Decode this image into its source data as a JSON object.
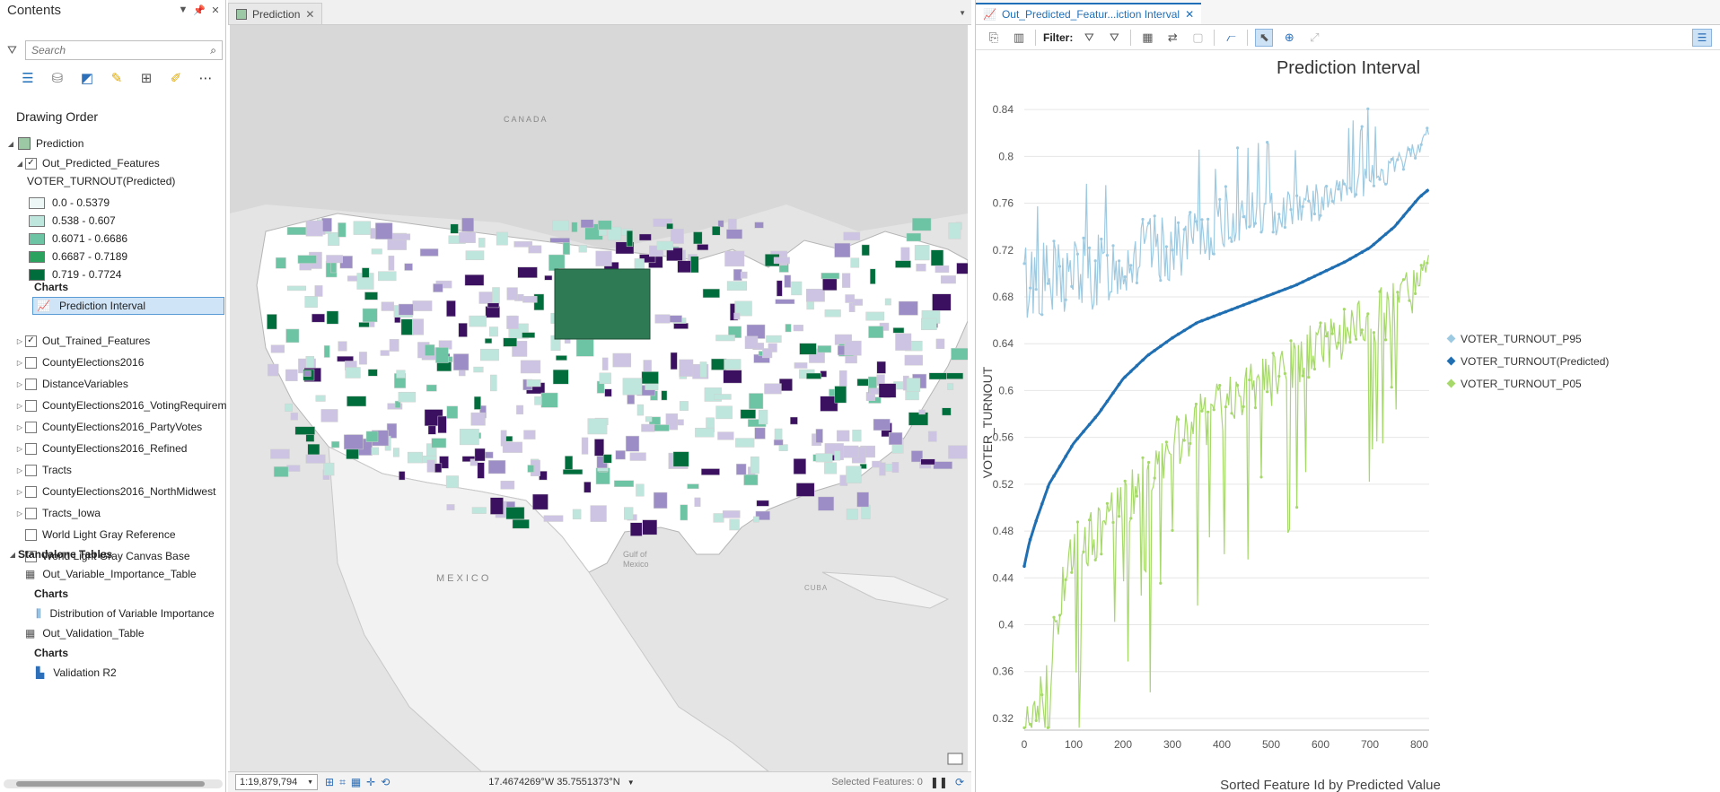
{
  "contents": {
    "title": "Contents",
    "search_placeholder": "Search",
    "drawing_order": "Drawing Order",
    "map_name": "Prediction",
    "layer_predicted": "Out_Predicted_Features",
    "legend_title": "VOTER_TURNOUT(Predicted)",
    "legend": [
      {
        "label": "0.0 - 0.5379",
        "color": "#edf8f6"
      },
      {
        "label": "0.538 - 0.607",
        "color": "#bfe6dc"
      },
      {
        "label": "0.6071 - 0.6686",
        "color": "#6cc4a4"
      },
      {
        "label": "0.6687 - 0.7189",
        "color": "#2ca25f"
      },
      {
        "label": "0.719 - 0.7724",
        "color": "#006d3c"
      }
    ],
    "charts_label": "Charts",
    "chart_prediction_interval": "Prediction Interval",
    "layers": [
      {
        "name": "Out_Trained_Features",
        "checked": true
      },
      {
        "name": "CountyElections2016",
        "checked": false
      },
      {
        "name": "DistanceVariables",
        "checked": false
      },
      {
        "name": "CountyElections2016_VotingRequirem",
        "checked": false
      },
      {
        "name": "CountyElections2016_PartyVotes",
        "checked": false
      },
      {
        "name": "CountyElections2016_Refined",
        "checked": false
      },
      {
        "name": "Tracts",
        "checked": false
      },
      {
        "name": "CountyElections2016_NorthMidwest",
        "checked": false
      },
      {
        "name": "Tracts_Iowa",
        "checked": false
      },
      {
        "name": "World Light Gray Reference",
        "checked": false
      },
      {
        "name": "World Light Gray Canvas Base",
        "checked": true
      }
    ],
    "standalone_tables": "Standalone Tables",
    "table1": "Out_Variable_Importance_Table",
    "table1_charts": "Charts",
    "table1_chart": "Distribution of Variable Importance",
    "table2": "Out_Validation_Table",
    "table2_charts": "Charts",
    "table2_chart": "Validation R2"
  },
  "map": {
    "tab_label": "Prediction",
    "labels": {
      "canada": "CANADA",
      "mexico": "MEXICO",
      "gulf1": "Gulf of",
      "gulf2": "Mexico",
      "cuba": "CUBA"
    },
    "scale": "1:19,879,794",
    "coords": "17.4674269°W 35.7551373°N",
    "selected_features": "Selected Features: 0",
    "colors": {
      "purple_light": "#cdc3e3",
      "purple_mid": "#9c8dc6",
      "purple_dark": "#3b1060",
      "basemap": "#e6e6e6",
      "land": "#ffffff"
    }
  },
  "chart_tab": {
    "label": "Out_Predicted_Featur...iction Interval",
    "filter_label": "Filter:"
  },
  "chart_data": {
    "type": "line",
    "title": "Prediction Interval",
    "xlabel": "Sorted Feature Id by Predicted Value",
    "ylabel": "VOTER_TURNOUT",
    "xlim": [
      0,
      820
    ],
    "ylim": [
      0.31,
      0.86
    ],
    "xticks": [
      0,
      100,
      200,
      300,
      400,
      500,
      600,
      700,
      800
    ],
    "yticks": [
      0.32,
      0.36,
      0.4,
      0.44,
      0.48,
      0.52,
      0.56,
      0.6,
      0.64,
      0.68,
      0.72,
      0.76,
      0.8,
      0.84
    ],
    "legend_position": "right",
    "series": [
      {
        "name": "VOTER_TURNOUT_P95",
        "color": "#9ecae1",
        "x": [
          0,
          25,
          50,
          100,
          150,
          200,
          250,
          300,
          350,
          400,
          450,
          500,
          550,
          600,
          650,
          700,
          750,
          800,
          820
        ],
        "y": [
          0.69,
          0.7,
          0.69,
          0.7,
          0.7,
          0.71,
          0.72,
          0.72,
          0.73,
          0.74,
          0.75,
          0.75,
          0.76,
          0.76,
          0.77,
          0.78,
          0.79,
          0.81,
          0.82
        ]
      },
      {
        "name": "VOTER_TURNOUT(Predicted)",
        "color": "#1f6fb2",
        "x": [
          0,
          10,
          25,
          50,
          100,
          150,
          200,
          250,
          300,
          350,
          400,
          450,
          500,
          550,
          600,
          650,
          700,
          750,
          800,
          820
        ],
        "y": [
          0.45,
          0.47,
          0.49,
          0.52,
          0.555,
          0.58,
          0.61,
          0.63,
          0.645,
          0.658,
          0.666,
          0.674,
          0.682,
          0.69,
          0.7,
          0.71,
          0.722,
          0.74,
          0.765,
          0.772
        ]
      },
      {
        "name": "VOTER_TURNOUT_P05",
        "color": "#a6d96a",
        "x": [
          0,
          25,
          50,
          75,
          100,
          150,
          200,
          250,
          300,
          350,
          400,
          450,
          500,
          550,
          600,
          650,
          700,
          750,
          800,
          820
        ],
        "y": [
          0.315,
          0.32,
          0.36,
          0.43,
          0.46,
          0.48,
          0.5,
          0.53,
          0.55,
          0.57,
          0.59,
          0.6,
          0.61,
          0.62,
          0.64,
          0.65,
          0.66,
          0.67,
          0.69,
          0.695
        ]
      }
    ]
  }
}
